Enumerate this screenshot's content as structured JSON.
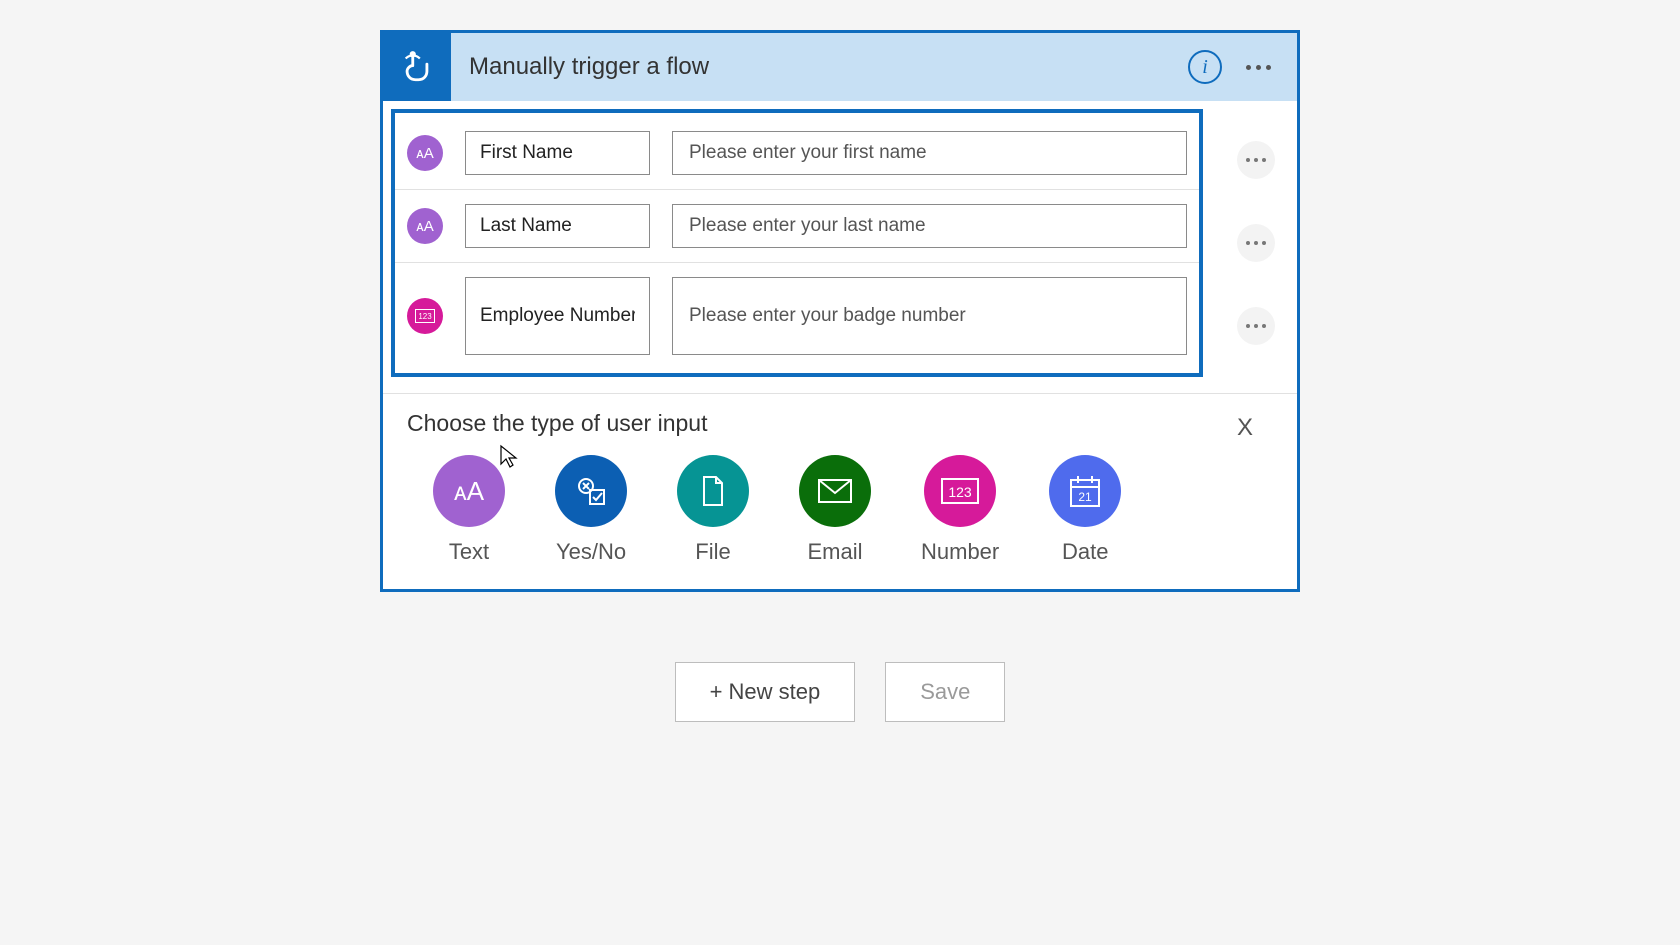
{
  "header": {
    "title": "Manually trigger a flow"
  },
  "inputs": [
    {
      "name": "First Name",
      "prompt": "Please enter your first name",
      "type": "text"
    },
    {
      "name": "Last Name",
      "prompt": "Please enter your last name",
      "type": "text"
    },
    {
      "name": "Employee Number",
      "prompt": "Please enter your badge number",
      "type": "number"
    }
  ],
  "choose": {
    "title": "Choose the type of user input",
    "options": [
      {
        "label": "Text",
        "key": "text"
      },
      {
        "label": "Yes/No",
        "key": "yesno"
      },
      {
        "label": "File",
        "key": "file"
      },
      {
        "label": "Email",
        "key": "email"
      },
      {
        "label": "Number",
        "key": "number"
      },
      {
        "label": "Date",
        "key": "date"
      }
    ]
  },
  "actions": {
    "new_step": "+ New step",
    "save": "Save"
  }
}
